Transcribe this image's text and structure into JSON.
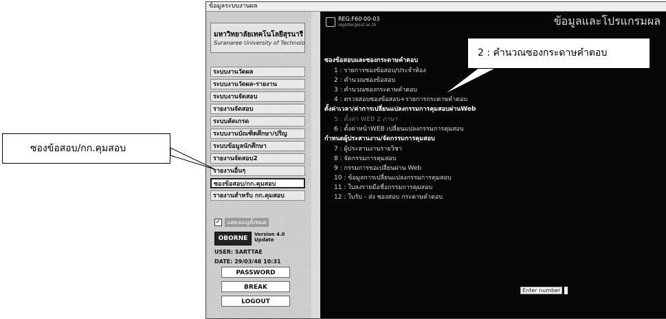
{
  "window": {
    "title": "ข้อมูลระบบงานผล"
  },
  "sidebar": {
    "brand_name": "มหาวิทยาลัยเทคโนโลยีสุรนารี",
    "brand_sub": "Suranaree University of Technology",
    "items": [
      {
        "label": "ระบบงานวัดผล"
      },
      {
        "label": "ระบบงานวัดผล-รายงาน"
      },
      {
        "label": "ระบบงานจัดสอบ"
      },
      {
        "label": "รายงานจัดสอบ"
      },
      {
        "label": "ระบบคัดเกรด"
      },
      {
        "label": "ระบบงานบัณฑิตศึกษา/ปริญ"
      },
      {
        "label": "ระบบข้อมูลนักศึกษา"
      },
      {
        "label": "รายงานจัดสอบ2"
      },
      {
        "label": "รายงานอื่นๆ"
      },
      {
        "label": "ซองข้อสอบ/กก.คุมสอบ"
      },
      {
        "label": "รายงานสำหรับ กก.คุมสอบ"
      }
    ],
    "checkbox_label": "แสดงเมนูทั้งหมด",
    "logo_text": "OBORNE",
    "version": "Version 4.0",
    "version_note": "Update",
    "user_line1": "USER: SARTTAE",
    "user_line2": "DATE: 29/03/48 10:31",
    "buttons": {
      "password": "PASSWORD",
      "break": "BREAK",
      "logout": "LOGOUT"
    }
  },
  "main": {
    "code": "REG:F60-00-03",
    "code_sub": "register@sut.ac.th",
    "title": "ข้อมูลและโปรแกรมผล",
    "sections": [
      {
        "title": "ซองข้อสอบและซองกระดาษคำตอบ",
        "options": [
          {
            "label": "1 : รายการซองข้อสอบ/ประจำห้อง",
            "dim": false
          },
          {
            "label": "2 : คำนวณซองข้อสอบ",
            "dim": false
          },
          {
            "label": "3 : คำนวณซองกระดาษคำตอบ",
            "dim": false
          },
          {
            "label": "4 : ตรวจสอบซองข้อสอบ+รายการกระดาษคำตอบ",
            "dim": false
          }
        ]
      },
      {
        "title": "ตั้งค่าเวลา/ค่าการเปลี่ยนแปลงกรรมการคุมสอบผ่านWeb",
        "options": [
          {
            "label": "5 : ตั้งค่า WEB 2 ภาษา",
            "dim": true
          },
          {
            "label": "6 : ตั้งค่าหน้าWEB เปลี่ยนแปลงกรรมการคุมสอบ",
            "dim": false
          }
        ]
      },
      {
        "title": "กำหนดผู้ประสานงาน/จัดกรรมการคุมสอบ",
        "options": [
          {
            "label": "7 : ผู้ประสานงานรายวิชา",
            "dim": false
          },
          {
            "label": "8 : จัดกรรมการคุมสอบ",
            "dim": false
          },
          {
            "label": "9 : กรรมการขอเปลี่ยนผ่าน Web",
            "dim": false
          },
          {
            "label": "10 : ข้อมูลการเปลี่ยนแปลงกรรมการคุมสอบ",
            "dim": false
          },
          {
            "label": "11 : ใบลงรายมือชื่อกรรมการคุมสอบ",
            "dim": false
          },
          {
            "label": "12 : ใบรับ - ส่ง ซองสอบ กระดาษคำตอบ",
            "dim": false
          }
        ]
      }
    ],
    "prompt_label": "Enter number"
  },
  "callouts": {
    "left": "ซองข้อสอบ/กก.คุมสอบ",
    "right": "2 : คำนวณซองกระดาษคำตอบ"
  }
}
